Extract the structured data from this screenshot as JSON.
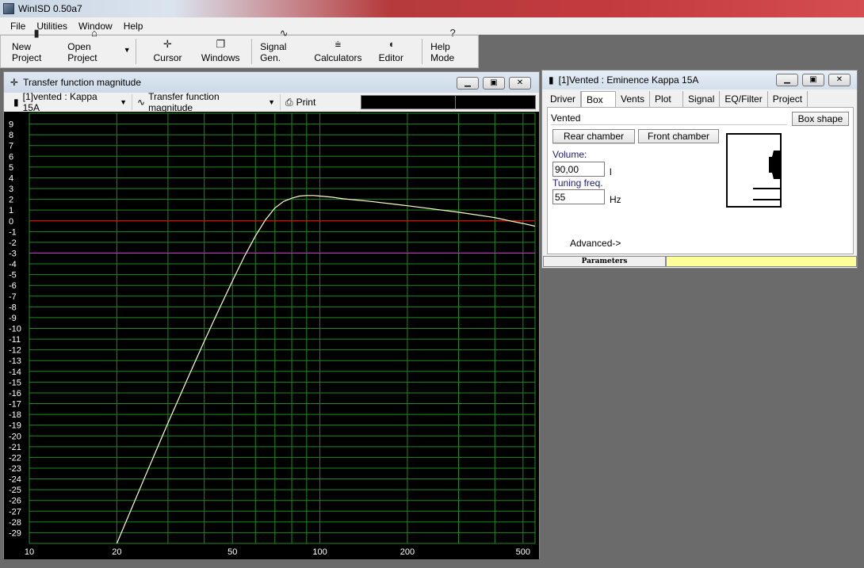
{
  "app": {
    "title": "WinISD 0.50a7"
  },
  "menu": [
    {
      "label": "File"
    },
    {
      "label": "Utilities"
    },
    {
      "label": "Window"
    },
    {
      "label": "Help"
    }
  ],
  "toolbar": {
    "buttons": [
      {
        "label": "New Project",
        "icon": "document-icon"
      },
      {
        "label": "Open Project",
        "icon": "folder-open-icon"
      },
      {
        "label": "Cursor",
        "icon": "crosshair-icon"
      },
      {
        "label": "Windows",
        "icon": "windows-icon"
      },
      {
        "label": "Signal Gen.",
        "icon": "sine-wave-icon"
      },
      {
        "label": "Calculators",
        "icon": "calculator-icon"
      },
      {
        "label": "Editor",
        "icon": "speaker-icon"
      },
      {
        "label": "Help Mode",
        "icon": "question-icon"
      }
    ]
  },
  "chart_window": {
    "title": "Transfer function magnitude",
    "project_select": "[1]vented : Kappa 15A",
    "graph_select": "Transfer function magnitude",
    "print_label": "Print"
  },
  "chart_data": {
    "type": "line",
    "title": "",
    "xlabel": "",
    "ylabel": "",
    "x_scale": "log",
    "xlim": [
      10,
      550
    ],
    "ylim": [
      -30,
      10
    ],
    "x_ticks": [
      10,
      20,
      50,
      100,
      200,
      500
    ],
    "y_ticks": [
      9,
      8,
      7,
      6,
      5,
      4,
      3,
      2,
      1,
      0,
      -1,
      -2,
      -3,
      -4,
      -5,
      -6,
      -7,
      -8,
      -9,
      -10,
      -11,
      -12,
      -13,
      -14,
      -15,
      -16,
      -17,
      -18,
      -19,
      -20,
      -21,
      -22,
      -23,
      -24,
      -25,
      -26,
      -27,
      -28,
      -29
    ],
    "grid": true,
    "reference_lines": [
      {
        "y": 0,
        "color": "#ff0000"
      },
      {
        "y": -3,
        "color": "#cc33cc"
      }
    ],
    "series": [
      {
        "color": "#ffffcc",
        "x": [
          20,
          25,
          30,
          35,
          40,
          45,
          50,
          55,
          60,
          65,
          70,
          75,
          80,
          85,
          90,
          95,
          100,
          110,
          120,
          150,
          200,
          300,
          400,
          450,
          500,
          550
        ],
        "y": [
          -30,
          -23.8,
          -18.8,
          -14.7,
          -11.2,
          -8.2,
          -5.6,
          -3.3,
          -1.4,
          0.1,
          1.2,
          1.8,
          2.1,
          2.3,
          2.35,
          2.35,
          2.3,
          2.2,
          2.05,
          1.8,
          1.4,
          0.8,
          0.3,
          0.0,
          -0.25,
          -0.5
        ]
      }
    ]
  },
  "box_window": {
    "title": "[1]Vented : Eminence Kappa 15A",
    "tabs": [
      {
        "label": "Driver"
      },
      {
        "label": "Box"
      },
      {
        "label": "Vents"
      },
      {
        "label": "Plot"
      },
      {
        "label": "Signal"
      },
      {
        "label": "EQ/Filter"
      },
      {
        "label": "Project"
      }
    ],
    "enclosure_type": "Vented",
    "box_shape_label": "Box shape",
    "rear_chamber_label": "Rear chamber",
    "front_chamber_label": "Front chamber",
    "volume_label": "Volume:",
    "volume_value": "90,00",
    "volume_unit": "l",
    "tuning_label": "Tuning freq.",
    "tuning_value": "55",
    "tuning_unit": "Hz",
    "advanced_label": "Advanced->",
    "status_left": "Parameters"
  },
  "colors": {
    "plot_bg": "#000000",
    "grid": "#1e8a1e",
    "curve": "#ffffcc"
  }
}
